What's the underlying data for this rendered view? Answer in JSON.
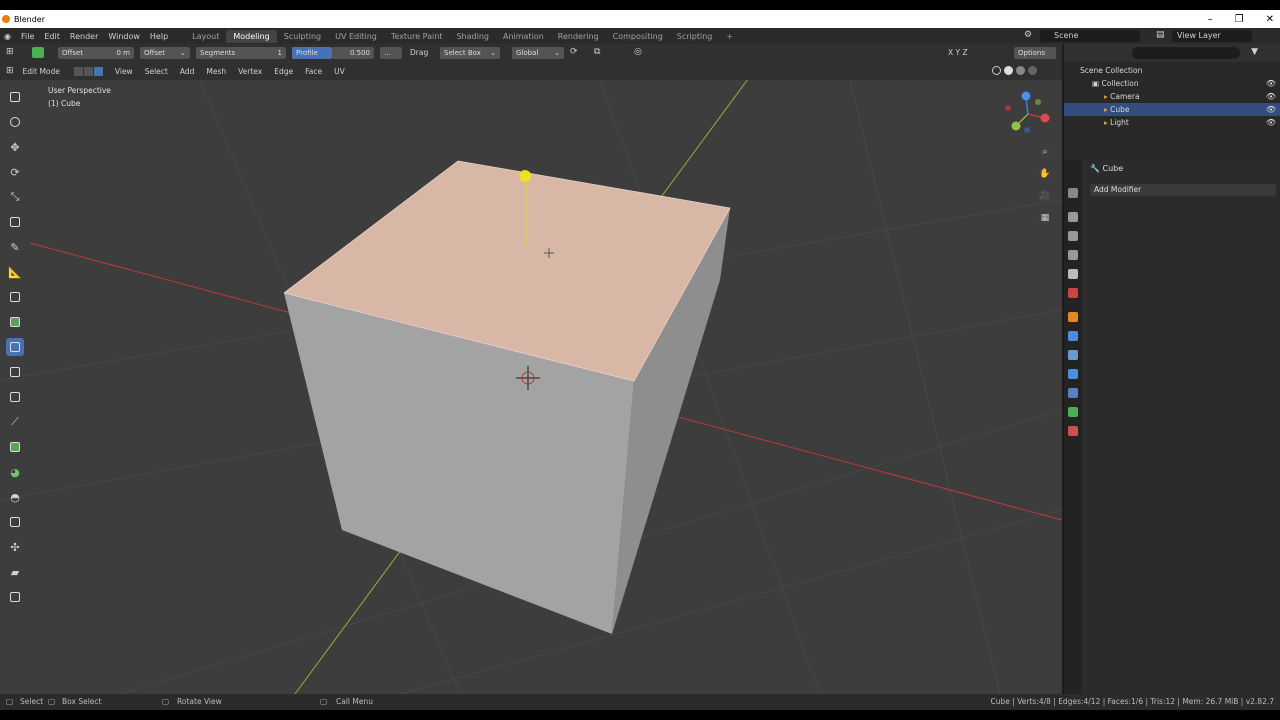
{
  "window": {
    "title": "Blender",
    "minimize": "–",
    "restore": "❐",
    "close": "✕"
  },
  "menu": [
    "File",
    "Edit",
    "Render",
    "Window",
    "Help"
  ],
  "workspaces": [
    "Layout",
    "Modeling",
    "Sculpting",
    "UV Editing",
    "Texture Paint",
    "Shading",
    "Animation",
    "Rendering",
    "Compositing",
    "Scripting"
  ],
  "active_workspace": "Modeling",
  "add_workspace": "+",
  "scene": "Scene",
  "view_layer": "View Layer",
  "tool_settings": {
    "width_type": "Offset",
    "width_value": "0 m",
    "offset_dropdown": "Offset",
    "segments_label": "Segments",
    "segments_value": "1",
    "profile_label": "Profile",
    "profile_value": "0.500",
    "drag_label": "Drag",
    "select_box": "Select Box",
    "orientation": "Global",
    "xyz": "X  Y  Z",
    "options": "Options"
  },
  "header": {
    "mode": "Edit Mode",
    "items": [
      "View",
      "Select",
      "Add",
      "Mesh",
      "Vertex",
      "Edge",
      "Face",
      "UV"
    ]
  },
  "viewport": {
    "view_name": "User Perspective",
    "object_label": "(1) Cube"
  },
  "gizmo": {
    "x": "X",
    "y": "Y",
    "z": "Z"
  },
  "outliner": {
    "root": "Scene Collection",
    "collection": "Collection",
    "items": [
      "Camera",
      "Cube",
      "Light"
    ],
    "selected": "Cube"
  },
  "properties": {
    "object_name": "Cube",
    "add_modifier": "Add Modifier"
  },
  "status": {
    "select": "Select",
    "box_select": "Box Select",
    "rotate": "Rotate View",
    "call_menu": "Call Menu",
    "stats": "Cube | Verts:4/8 | Edges:4/12 | Faces:1/6 | Tris:12 | Mem: 26.7 MiB | v2.82.7"
  },
  "colors": {
    "viewport_bg": "#3d3d3d",
    "selected_face": "#d8b7a6",
    "active_blue": "#4772b3",
    "x_axis": "#c0373e",
    "y_axis": "#8fb23a"
  }
}
